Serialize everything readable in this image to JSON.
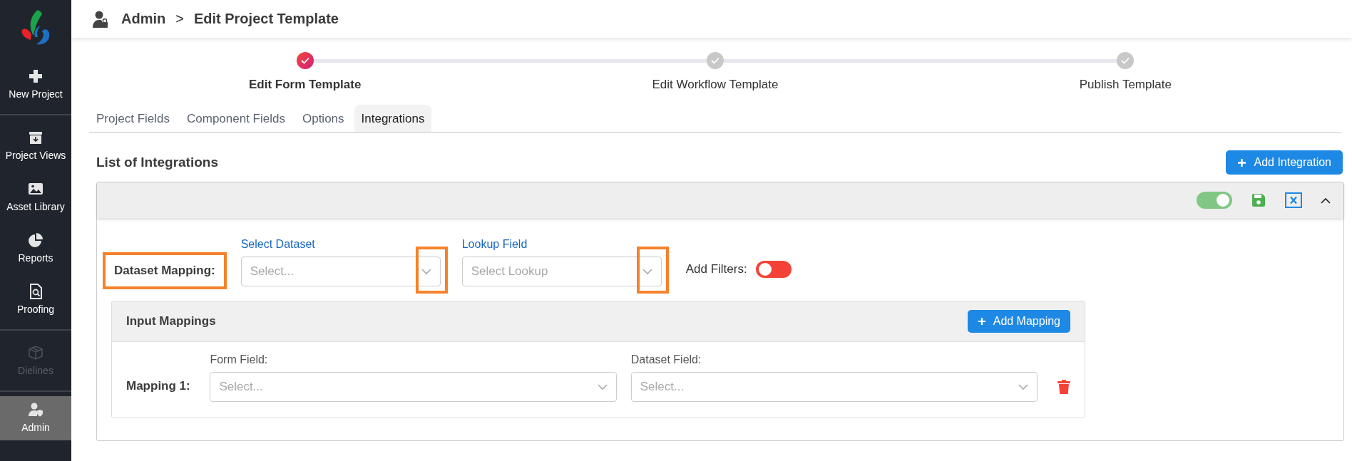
{
  "sidebar": {
    "items": [
      {
        "label": "New Project",
        "disabled": false,
        "selected": false,
        "divider_after": true
      },
      {
        "label": "Project Views",
        "disabled": false,
        "selected": false,
        "divider_after": false
      },
      {
        "label": "Asset Library",
        "disabled": false,
        "selected": false,
        "divider_after": false
      },
      {
        "label": "Reports",
        "disabled": false,
        "selected": false,
        "divider_after": false
      },
      {
        "label": "Proofing",
        "disabled": false,
        "selected": false,
        "divider_after": true
      },
      {
        "label": "Dielines",
        "disabled": true,
        "selected": false,
        "divider_after": true
      },
      {
        "label": "Admin",
        "disabled": false,
        "selected": true,
        "divider_after": false
      }
    ]
  },
  "header": {
    "breadcrumb": [
      "Admin",
      "Edit Project Template"
    ],
    "separator": ">"
  },
  "stepper": [
    {
      "label": "Edit Form Template",
      "selected": true
    },
    {
      "label": "Edit Workflow Template",
      "selected": false
    },
    {
      "label": "Publish Template",
      "selected": false
    }
  ],
  "tabs": [
    {
      "label": "Project Fields",
      "selected": false
    },
    {
      "label": "Component Fields",
      "selected": false
    },
    {
      "label": "Options",
      "selected": false
    },
    {
      "label": "Integrations",
      "selected": true
    }
  ],
  "section": {
    "title": "List of Integrations",
    "add_button": "Add Integration"
  },
  "integration": {
    "enabled": true,
    "expanded": true,
    "dataset_mapping": {
      "label": "Dataset Mapping:",
      "highlighted": true
    },
    "fields": [
      {
        "label": "Select Dataset",
        "placeholder": "Select...",
        "highlighted": true
      },
      {
        "label": "Lookup Field",
        "placeholder": "Select Lookup",
        "highlighted": true
      }
    ],
    "filters": {
      "label": "Add Filters:",
      "on": false
    },
    "input_mappings": {
      "title": "Input Mappings",
      "add_button": "Add Mapping",
      "rows": [
        {
          "label": "Mapping 1:",
          "form_field": {
            "label": "Form Field:",
            "placeholder": "Select..."
          },
          "dataset_field": {
            "label": "Dataset Field:",
            "placeholder": "Select..."
          }
        }
      ]
    }
  }
}
